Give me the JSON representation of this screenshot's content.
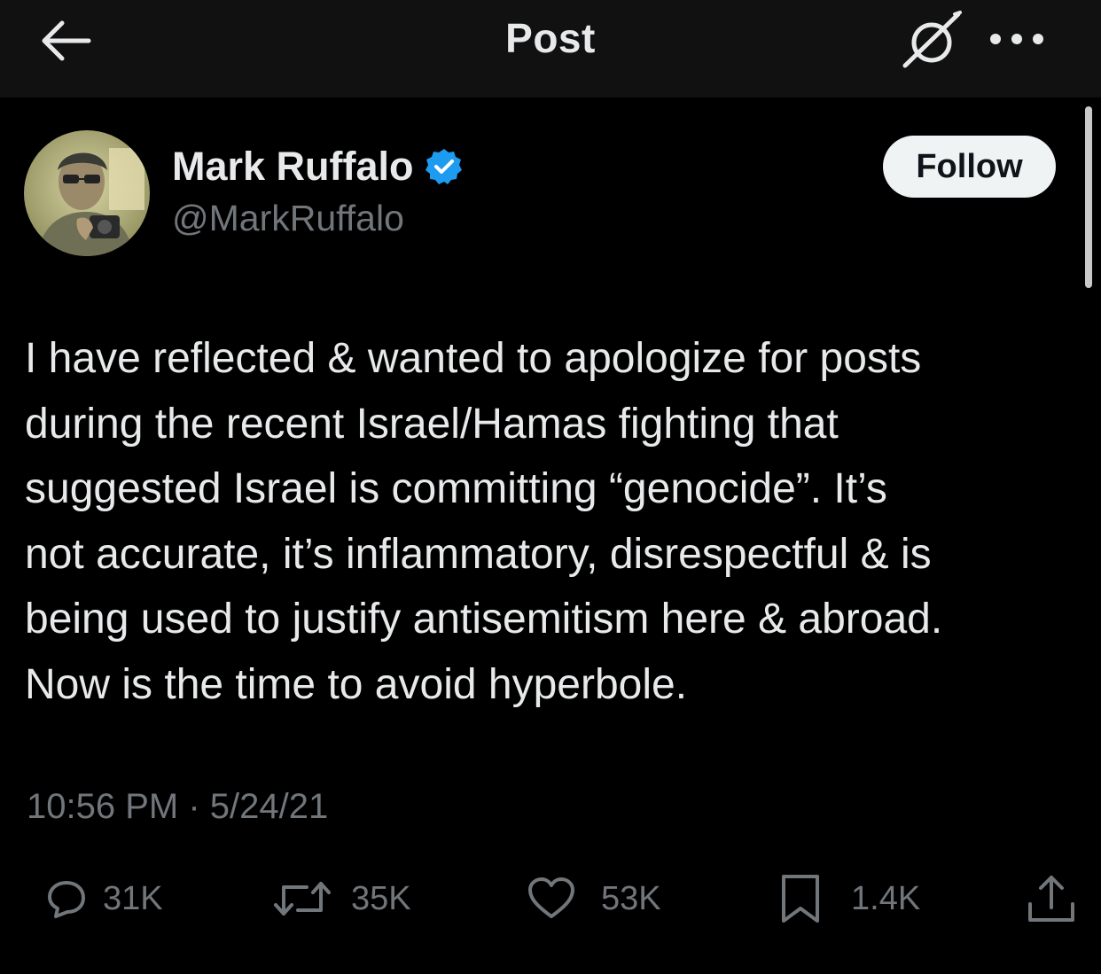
{
  "header": {
    "title": "Post",
    "back_icon": "arrow-left-icon",
    "grok_icon": "grok-icon",
    "more_icon": "more-horizontal-icon"
  },
  "author": {
    "display_name": "Mark Ruffalo",
    "handle": "@MarkRuffalo",
    "verified": true,
    "verified_color": "#1d9bf0",
    "avatar_icon": "profile-photo"
  },
  "follow_button": {
    "label": "Follow"
  },
  "tweet": {
    "text": "I have reflected & wanted to apologize for posts\nduring the recent Israel/Hamas fighting that\nsuggested Israel is committing “genocide”. It’s\nnot accurate, it’s inflammatory, disrespectful & is\nbeing used to justify antisemitism here & abroad.\nNow is the time to avoid hyperbole.",
    "timestamp": "10:56 PM · 5/24/21"
  },
  "actions": {
    "replies": {
      "icon": "reply-icon",
      "count": "31K"
    },
    "reposts": {
      "icon": "repost-icon",
      "count": "35K"
    },
    "likes": {
      "icon": "heart-icon",
      "count": "53K"
    },
    "bookmarks": {
      "icon": "bookmark-icon",
      "count": "1.4K"
    },
    "share": {
      "icon": "share-icon"
    }
  },
  "colors": {
    "background": "#000000",
    "header_background": "#111111",
    "primary_text": "#e7e9ea",
    "secondary_text": "#71767b",
    "follow_button_bg": "#eff3f4"
  }
}
